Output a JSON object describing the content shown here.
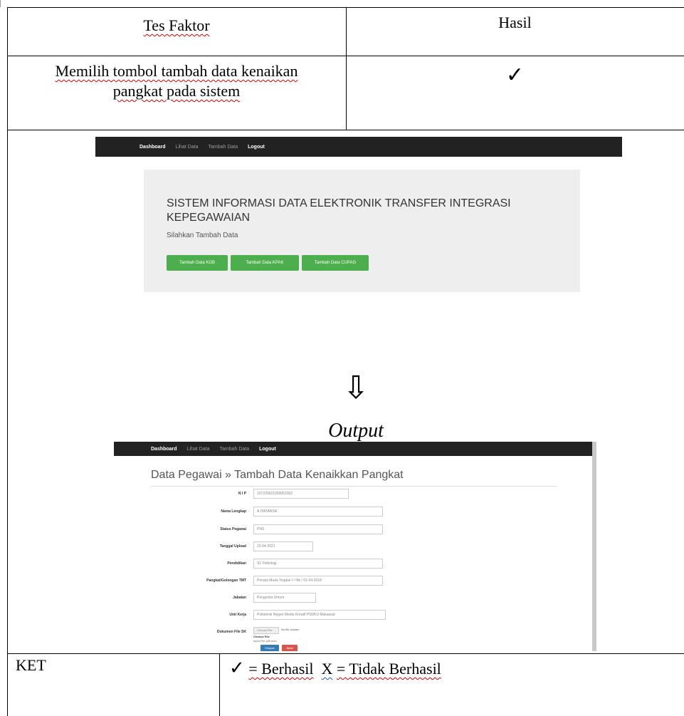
{
  "table": {
    "header_left": "Tes Faktor",
    "header_right": "Hasil",
    "row1_left_line1": "Memilih tombol tambah data kenaikan",
    "row1_left_line2": "pangkat pada sistem",
    "row1_right": "✓",
    "arrow": "⇩",
    "output_label": "Output",
    "ket_label": "KET",
    "ket_check": "✓",
    "ket_berhasil": "= Berhasil",
    "ket_x": "X",
    "ket_tidak": "= Tidak Berhasil"
  },
  "screen1": {
    "nav": [
      "Dashboard",
      "Lihat Data",
      "Tambah Data",
      "Logout"
    ],
    "title_line1": "SISTEM INFORMASI DATA ELEKTRONIK TRANSFER INTEGRASI",
    "title_line2": "KEPEGAWAIAN",
    "subtitle": "Silahkan Tambah Data",
    "buttons": [
      "Tambah Data KGB",
      "Tambah Data KPAK",
      "Tambah Data CUPAG"
    ]
  },
  "screen2": {
    "nav": [
      "Dashboard",
      "Lihat Data",
      "Tambah Data",
      "Logout"
    ],
    "heading": "Data Pegawai » Tambah Data Kenaikkan Pangkat",
    "fields": [
      {
        "label": "N I P",
        "value": "197220921009052002"
      },
      {
        "label": "Nama Lengkap",
        "value": "A IYATANSA"
      },
      {
        "label": "Status Pegawai",
        "value": "PNS"
      },
      {
        "label": "Tanggal Upload",
        "value": "23-04-2021"
      },
      {
        "label": "Pendidikan",
        "value": "S1 Psikologi"
      },
      {
        "label": "Pangkat/Golongan TMT",
        "value": "Penata Muda Tingkat I / IIIb / 01-04-2018"
      },
      {
        "label": "Jabatan",
        "value": "Pengelola Umum"
      },
      {
        "label": "Unit Kerja",
        "value": "Politeknik Negeri Media Kreatif PSDKU Makassar"
      },
      {
        "label": "Dokumen File SK",
        "value": "Choose File"
      }
    ],
    "file_note": "No file chosen",
    "file_hint1": "Choose File",
    "file_hint2": "Input File pdf.docx",
    "btn_simpan": "Simpan",
    "btn_batal": "Batal"
  }
}
